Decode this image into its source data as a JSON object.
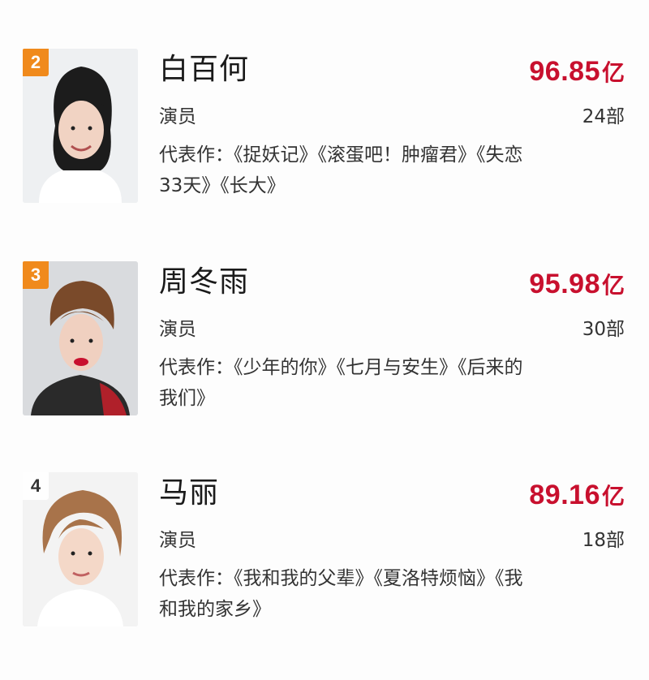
{
  "ranking": [
    {
      "rank": "2",
      "name": "白百何",
      "box_office_value": "96.85",
      "box_office_unit": "亿",
      "role": "演员",
      "film_count": "24部",
      "works_prefix": "代表作：",
      "works": "《捉妖记》《滚蛋吧！肿瘤君》《失恋33天》《长大》",
      "badge_color": "#f08a1c"
    },
    {
      "rank": "3",
      "name": "周冬雨",
      "box_office_value": "95.98",
      "box_office_unit": "亿",
      "role": "演员",
      "film_count": "30部",
      "works_prefix": "代表作：",
      "works": "《少年的你》《七月与安生》《后来的我们》",
      "badge_color": "#f08a1c"
    },
    {
      "rank": "4",
      "name": "马丽",
      "box_office_value": "89.16",
      "box_office_unit": "亿",
      "role": "演员",
      "film_count": "18部",
      "works_prefix": "代表作：",
      "works": "《我和我的父辈》《夏洛特烦恼》《我和我的家乡》",
      "badge_color": "none"
    }
  ],
  "colors": {
    "score": "#c8102e",
    "badge": "#f08a1c",
    "background": "#fdfdfd"
  }
}
